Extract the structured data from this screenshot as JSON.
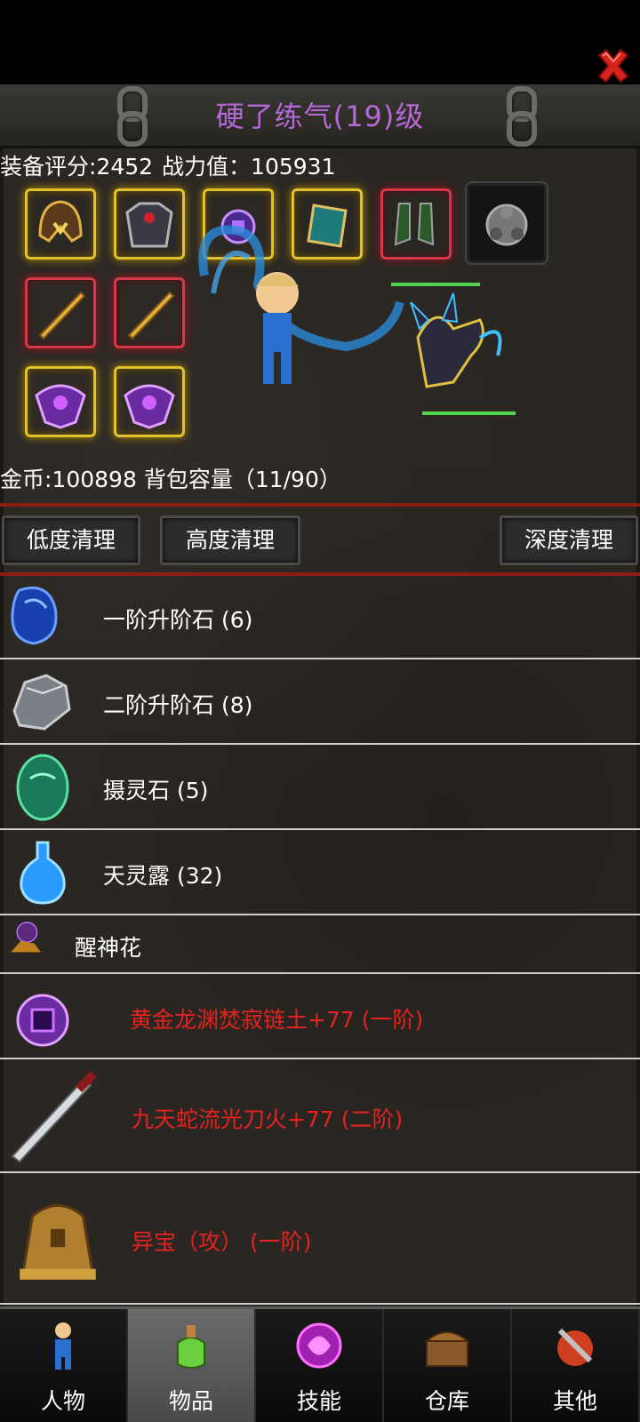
{
  "window": {
    "title": "硬了练气(19)级"
  },
  "stats": {
    "equip_score": "装备评分:2452",
    "power": "战力值：105931"
  },
  "inventory": {
    "gold": "金币:100898",
    "capacity": "背包容量（11/90）"
  },
  "buttons": {
    "low_clean": "低度清理",
    "high_clean": "高度清理",
    "deep_clean": "深度清理"
  },
  "items": [
    {
      "name": "一阶升阶石 (6)",
      "color": "#ffffff",
      "icon": "blue-stone-icon"
    },
    {
      "name": "二阶升阶石 (8)",
      "color": "#ffffff",
      "icon": "grey-stone-icon"
    },
    {
      "name": "摄灵石 (5)",
      "color": "#ffffff",
      "icon": "green-egg-icon"
    },
    {
      "name": "天灵露 (32)",
      "color": "#ffffff",
      "icon": "blue-potion-icon"
    },
    {
      "name": "醒神花",
      "color": "#ffffff",
      "icon": "purple-flower-icon"
    },
    {
      "name": "黄金龙渊焚寂链土+77 (一阶)",
      "color": "#e4221f",
      "icon": "amulet-icon"
    },
    {
      "name": "九天蛇流光刀火+77 (二阶)",
      "color": "#e4221f",
      "icon": "sword-icon"
    },
    {
      "name": "异宝（攻） (一阶)",
      "color": "#e4221f",
      "icon": "bell-icon"
    }
  ],
  "tabs": [
    {
      "label": "人物",
      "icon": "character-icon"
    },
    {
      "label": "物品",
      "icon": "potion-bag-icon"
    },
    {
      "label": "技能",
      "icon": "skill-orb-icon"
    },
    {
      "label": "仓库",
      "icon": "chest-icon"
    },
    {
      "label": "其他",
      "icon": "other-icon"
    }
  ],
  "active_tab": "物品"
}
